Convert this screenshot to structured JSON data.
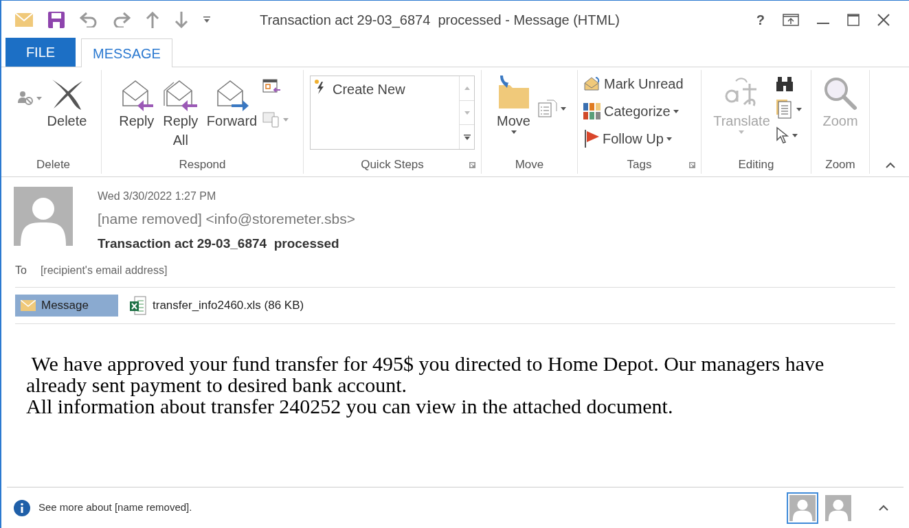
{
  "window": {
    "title": "Transaction act 29-03_6874  processed - Message (HTML)",
    "help": "?"
  },
  "tabs": [
    {
      "label": "FILE",
      "kind": "file",
      "selected": false
    },
    {
      "label": "MESSAGE",
      "kind": "tab",
      "selected": true
    }
  ],
  "ribbon": {
    "groups": [
      {
        "label": "Delete",
        "commands": [
          {
            "label": "Delete",
            "kind": "large",
            "dropdown": false,
            "disabled": false
          }
        ]
      },
      {
        "label": "Respond",
        "commands": [
          {
            "label": "Reply",
            "kind": "large",
            "dropdown": false,
            "disabled": false
          },
          {
            "label": "Reply All",
            "kind": "large",
            "dropdown": false,
            "disabled": false
          },
          {
            "label": "Forward",
            "kind": "large",
            "dropdown": false,
            "disabled": false
          }
        ]
      },
      {
        "label": "Quick Steps",
        "commands": [
          {
            "label": "Create New",
            "kind": "gallery"
          }
        ]
      },
      {
        "label": "Move",
        "commands": [
          {
            "label": "Move",
            "kind": "large",
            "dropdown": true,
            "disabled": false
          }
        ]
      },
      {
        "label": "Tags",
        "commands": [
          {
            "label": "Mark Unread",
            "kind": "small",
            "dropdown": false,
            "disabled": false
          },
          {
            "label": "Categorize",
            "kind": "small",
            "dropdown": true,
            "disabled": false
          },
          {
            "label": "Follow Up",
            "kind": "small",
            "dropdown": true,
            "disabled": false
          }
        ]
      },
      {
        "label": "Editing",
        "commands": [
          {
            "label": "Translate",
            "kind": "large",
            "dropdown": true,
            "disabled": true
          }
        ]
      },
      {
        "label": "Zoom",
        "commands": [
          {
            "label": "Zoom",
            "kind": "large",
            "dropdown": false,
            "disabled": true
          }
        ]
      }
    ]
  },
  "header": {
    "date": "Wed 3/30/2022 1:27 PM",
    "sender": "[name removed] <info@storemeter.sbs>",
    "subject": "Transaction act 29-03_6874  processed",
    "to_label": "To",
    "to": "[recipient's email address]"
  },
  "attachments": [
    {
      "label": "Message",
      "kind": "message",
      "selected": true
    },
    {
      "label": "transfer_info2460.xls (86 KB)",
      "kind": "excel",
      "selected": false
    }
  ],
  "body": [
    " We have approved your fund transfer for 495$ you directed to Home Depot. Our managers have already sent payment to desired bank account.",
    "All information about transfer 240252 you can view in the attached document."
  ],
  "people_pane": {
    "text": "See more about [name removed].",
    "avatars": [
      {
        "selected": true
      },
      {
        "selected": false
      }
    ]
  }
}
